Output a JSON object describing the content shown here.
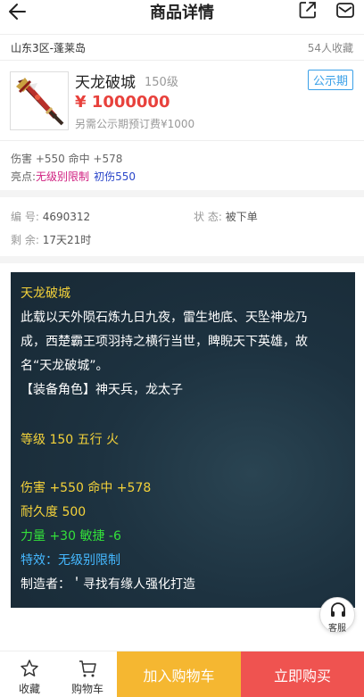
{
  "header": {
    "title": "商品详情"
  },
  "info_bar": {
    "server": "山东3区-蓬莱岛",
    "favorites": "54人收藏"
  },
  "product": {
    "name": "天龙破城",
    "level": "150级",
    "badge": "公示期",
    "price": "¥ 1000000",
    "deposit": "另需公示期预订费¥1000"
  },
  "attributes": {
    "stats": "伤害 +550 命中 +578",
    "highlight_label": "亮点:",
    "highlight_tag1": "无级别限制",
    "highlight_tag2": "初伤550"
  },
  "meta": {
    "id_label": "编 号:",
    "id_value": "4690312",
    "status_label": "状 态:",
    "status_value": "被下单",
    "remain_label": "剩 余:",
    "remain_value": "17天21时"
  },
  "description": {
    "title": "天龙破城",
    "line1": "此载以天外陨石炼九日九夜，雷生地底、天坠神龙乃",
    "line2": "成，西楚霸王项羽持之横行当世，睥睨天下英雄，故",
    "line3": "名“天龙破城”。",
    "line4": "【装备角色】神天兵，龙太子",
    "level": "等级 150 五行 火",
    "damage": "伤害 +550 命中 +578",
    "durability": "耐久度 500",
    "strength": "力量 +30 敏捷 -6",
    "special": "特效：无级别限制",
    "maker": "制造者：＇寻找有缘人强化打造"
  },
  "service": {
    "label": "客服"
  },
  "footer": {
    "favorite": "收藏",
    "cart": "购物车",
    "add_to_cart": "加入购物车",
    "buy_now": "立即购买"
  },
  "colors": {
    "price": "#e8413c",
    "badge": "#3aa0e8",
    "add_to_cart_bg": "#f5b731",
    "buy_now_bg": "#ef5350",
    "panel_bg": "#1d3240",
    "desc_gold": "#f4d23a",
    "desc_green": "#33e03a",
    "desc_blue": "#45b8ff"
  },
  "icons": [
    "back-arrow-icon",
    "share-icon",
    "message-icon",
    "star-icon",
    "cart-icon",
    "headset-icon"
  ]
}
